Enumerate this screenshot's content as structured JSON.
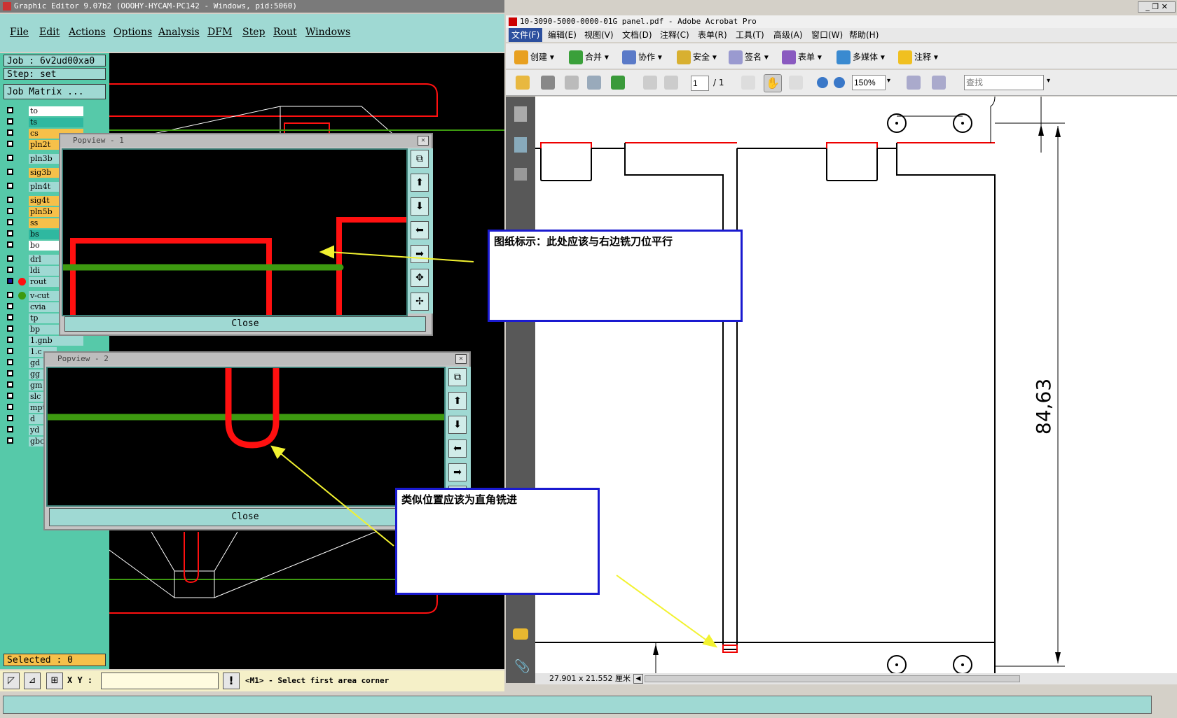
{
  "left_app": {
    "title": "Graphic Editor 9.07b2 (OOOHY-HYCAM-PC142 - Windows, pid:5060)",
    "menu": [
      "File",
      "Edit",
      "Actions",
      "Options",
      "Analysis",
      "DFM",
      "Step",
      "Rout",
      "Windows"
    ],
    "job_label": "Job : 6v2ud00xa0",
    "step_label": "Step: set",
    "job_matrix_button": "Job Matrix ...",
    "layers": [
      {
        "name": "to",
        "color": "#ffffff"
      },
      {
        "name": "ts",
        "color": "#2fb8a0"
      },
      {
        "name": "cs",
        "color": "#f6c04a"
      },
      {
        "name": "pln2t",
        "color": "#f6c04a"
      },
      {
        "name": "pln3b",
        "color": "#9fd9d3"
      },
      {
        "name": "sig3b",
        "color": "#f6c04a"
      },
      {
        "name": "pln4t",
        "color": "#9fd9d3"
      },
      {
        "name": "sig4t",
        "color": "#f6c04a"
      },
      {
        "name": "pln5b",
        "color": "#f6c04a"
      },
      {
        "name": "ss",
        "color": "#f6c04a"
      },
      {
        "name": "bs",
        "color": "#2fb8a0"
      },
      {
        "name": "bo",
        "color": "#ffffff"
      },
      {
        "name": "drl",
        "color": "#9fd9d3"
      },
      {
        "name": "ldi",
        "color": "#9fd9d3"
      },
      {
        "name": "rout",
        "color": "#9fd9d3"
      },
      {
        "name": "v-cut",
        "color": "#9fd9d3"
      },
      {
        "name": "cvia",
        "color": "#9fd9d3"
      },
      {
        "name": "tp",
        "color": "#9fd9d3"
      },
      {
        "name": "bp",
        "color": "#9fd9d3"
      },
      {
        "name": "1.gnb",
        "color": "#9fd9d3"
      },
      {
        "name": "1.c",
        "color": "#9fd9d3"
      },
      {
        "name": "gd",
        "color": "#9fd9d3"
      },
      {
        "name": "gg",
        "color": "#9fd9d3"
      },
      {
        "name": "gm",
        "color": "#9fd9d3"
      },
      {
        "name": "slc",
        "color": "#9fd9d3"
      },
      {
        "name": "mpt",
        "color": "#9fd9d3"
      },
      {
        "name": "d",
        "color": "#9fd9d3"
      },
      {
        "name": "yd",
        "color": "#9fd9d3"
      },
      {
        "name": "gbc",
        "color": "#9fd9d3"
      }
    ],
    "selected": "Selected : 0",
    "xy_label": "X Y :",
    "xy_value": "",
    "status_hint": "<M1> - Select first area corner",
    "popview1_title": "Popview - 1",
    "popview2_title": "Popview - 2",
    "close_label": "Close"
  },
  "acrobat": {
    "title": "10-3090-5000-0000-01G panel.pdf - Adobe Acrobat Pro",
    "menu": [
      "文件(F)",
      "编辑(E)",
      "视图(V)",
      "文档(D)",
      "注释(C)",
      "表单(R)",
      "工具(T)",
      "高级(A)",
      "窗口(W)",
      "帮助(H)"
    ],
    "toolbar": [
      "创建",
      "合并",
      "协作",
      "安全",
      "签名",
      "表单",
      "多媒体",
      "注释"
    ],
    "page_current": "1",
    "page_total": "/ 1",
    "zoom": "150%",
    "search_placeholder": "查找",
    "page_size": "27.901 x 21.552 厘米",
    "dimension_label": "84,63"
  },
  "callouts": {
    "top": "图纸标示：此处应该与右边铣刀位平行",
    "bottom": "类似位置应该为直角铣进"
  },
  "colors": {
    "teal": "#9fd9d3",
    "sidebar": "#56c9a9",
    "rout_red": "#ff1010",
    "green_line": "#3d9a10",
    "callout_border": "#1a1ad0",
    "arrow": "#f2f230"
  }
}
